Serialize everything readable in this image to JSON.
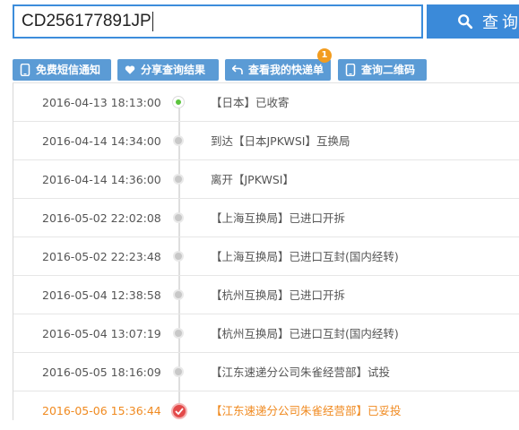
{
  "search": {
    "value": "CD256177891JP",
    "button_label": "查询"
  },
  "actions": [
    {
      "label": "免费短信通知",
      "icon": "phone-icon"
    },
    {
      "label": "分享查询结果",
      "icon": "heart-icon"
    },
    {
      "label": "查看我的快递单",
      "icon": "back-arrow-icon"
    },
    {
      "label": "查询二维码",
      "icon": "phone-icon"
    }
  ],
  "badge_count": "1",
  "colors": {
    "primary": "#3b8ad9",
    "button": "#5b9bd5",
    "highlight": "#f08a20",
    "badge": "#f29c1f"
  },
  "events": [
    {
      "time": "2016-04-13 18:13:00",
      "desc": "【日本】已收寄"
    },
    {
      "time": "2016-04-14 14:34:00",
      "desc": "到达【日本JPKWSI】互换局"
    },
    {
      "time": "2016-04-14 14:36:00",
      "desc": "离开【JPKWSI】"
    },
    {
      "time": "2016-05-02 22:02:08",
      "desc": "【上海互换局】已进口开拆"
    },
    {
      "time": "2016-05-02 22:23:48",
      "desc": "【上海互换局】已进口互封(国内经转)"
    },
    {
      "time": "2016-05-04 12:38:58",
      "desc": "【杭州互换局】已进口开拆"
    },
    {
      "time": "2016-05-04 13:07:19",
      "desc": "【杭州互换局】已进口互封(国内经转)"
    },
    {
      "time": "2016-05-05 18:16:09",
      "desc": "【江东速递分公司朱雀经营部】试投"
    },
    {
      "time": "2016-05-06 15:36:44",
      "desc": "【江东速递分公司朱雀经营部】已妥投"
    }
  ]
}
